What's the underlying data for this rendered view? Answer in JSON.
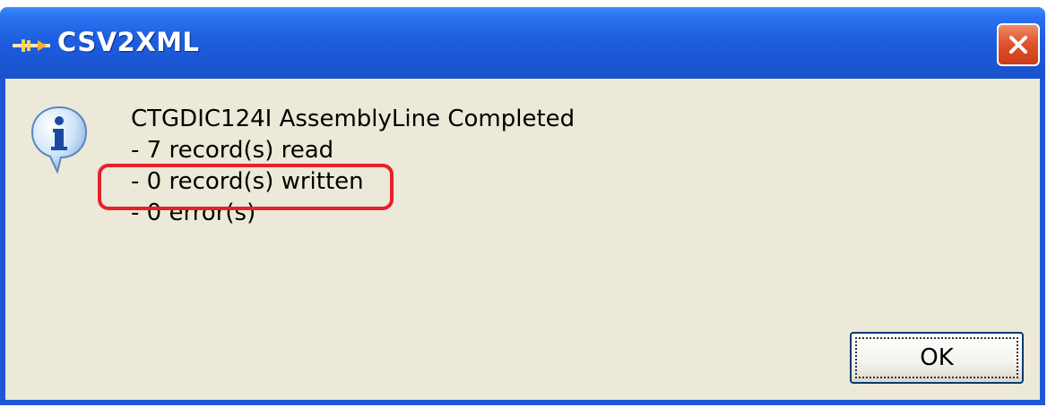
{
  "window": {
    "title": "CSV2XML",
    "close_icon": "close-icon",
    "app_icon": "app-icon"
  },
  "dialog": {
    "icon": "info-icon",
    "lines": [
      "CTGDIC124I AssemblyLine Completed",
      "- 7 record(s) read",
      "- 0 record(s) written",
      "- 0 error(s)"
    ],
    "highlighted_line": 2,
    "ok_label": "OK"
  },
  "colors": {
    "titlebar": "#1b58d6",
    "client": "#ece9d8",
    "close_button": "#e0542c",
    "highlight": "#e8202a"
  }
}
